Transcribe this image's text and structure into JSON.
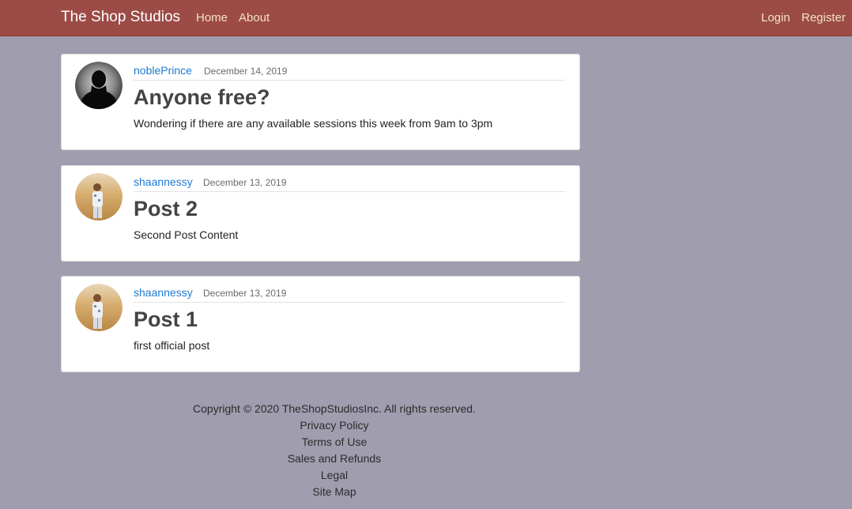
{
  "navbar": {
    "brand": "The Shop Studios",
    "links": {
      "home": "Home",
      "about": "About",
      "login": "Login",
      "register": "Register"
    },
    "colors": {
      "background": "#9c4b46",
      "link": "#f3e3c8",
      "brand": "#ffffff"
    }
  },
  "posts": [
    {
      "author": "noblePrince",
      "date": "December 14, 2019",
      "title": "Anyone free?",
      "content": "Wondering if there are any available sessions this week from 9am to 3pm",
      "avatar": "silhouette-avatar"
    },
    {
      "author": "shaannessy",
      "date": "December 13, 2019",
      "title": "Post 2",
      "content": "Second Post Content",
      "avatar": "photo-avatar"
    },
    {
      "author": "shaannessy",
      "date": "December 13, 2019",
      "title": "Post 1",
      "content": "first official post",
      "avatar": "photo-avatar"
    }
  ],
  "footer": {
    "copyright": "Copyright © 2020 TheShopStudiosInc. All rights reserved.",
    "links": [
      "Privacy Policy",
      "Terms of Use",
      "Sales and Refunds",
      "Legal",
      "Site Map"
    ]
  },
  "colors": {
    "page_background": "#a09dae",
    "card_background": "#ffffff",
    "author_link": "#1f7ad1"
  }
}
